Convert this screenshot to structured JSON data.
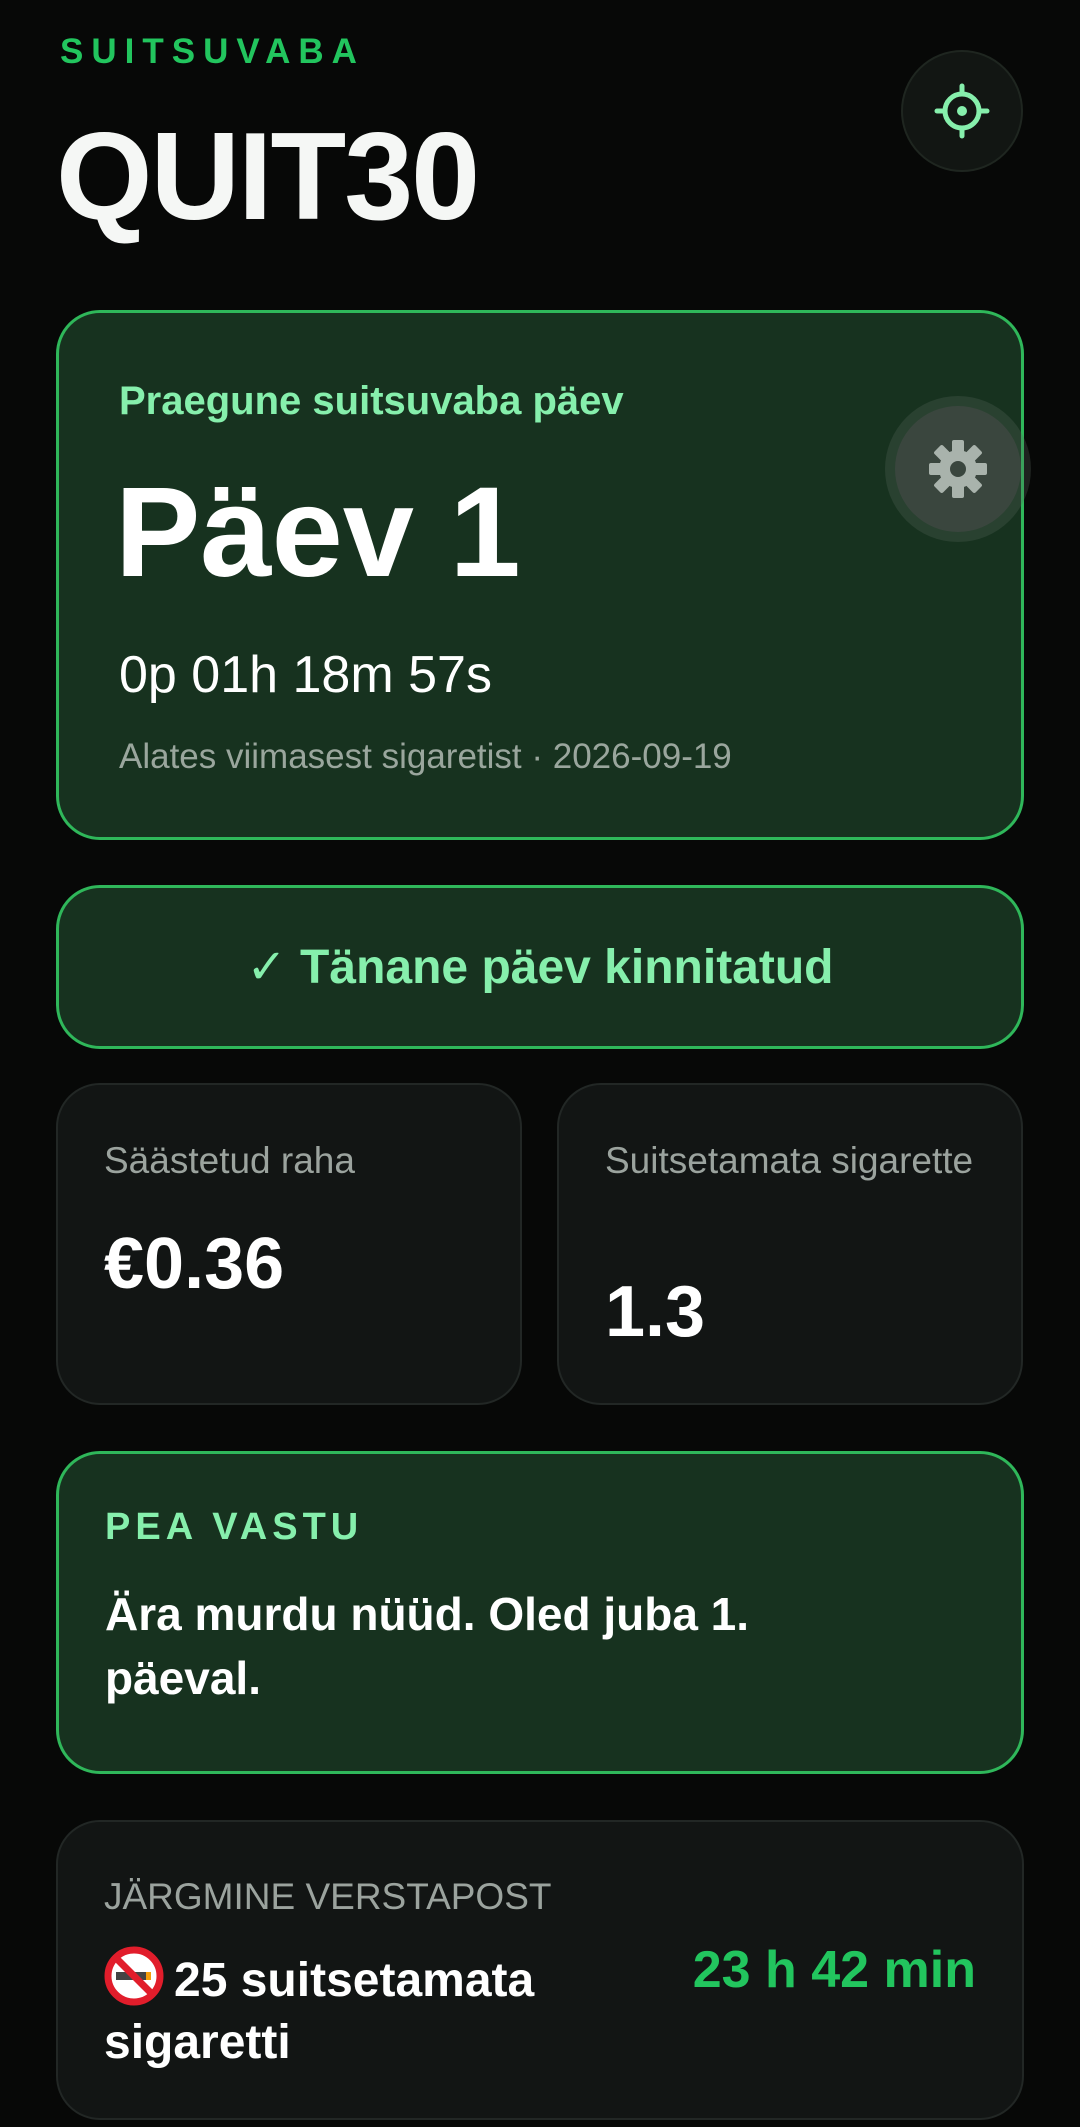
{
  "header": {
    "brand_subtitle": "SUITSUVABA",
    "app_title": "QUIT30"
  },
  "streak": {
    "label": "Praegune suitsuvaba päev",
    "day": "Päev 1",
    "timer": "0p 01h 18m 57s",
    "since": "Alates viimasest sigaretist · 2026-09-19"
  },
  "confirm": {
    "label": "✓ Tänane päev kinnitatud"
  },
  "stats": {
    "money_label": "Säästetud raha",
    "money_value": "€0.36",
    "cigs_label": "Suitsetamata sigarette",
    "cigs_value": "1.3"
  },
  "quote": {
    "label": "PEA VASTU",
    "text": "Ära murdu nüüd. Oled juba 1. päeval."
  },
  "milestone": {
    "label": "JÄRGMINE VERSTAPOST",
    "name": "25 suitsetamata sigaretti",
    "icon": "no-smoking-icon",
    "time": "23 h 42 min"
  },
  "colors": {
    "accent": "#22c55e",
    "accent_light": "#86efac",
    "card_green_bg": "#17321f",
    "card_dark_bg": "#121514",
    "background": "#070807"
  }
}
